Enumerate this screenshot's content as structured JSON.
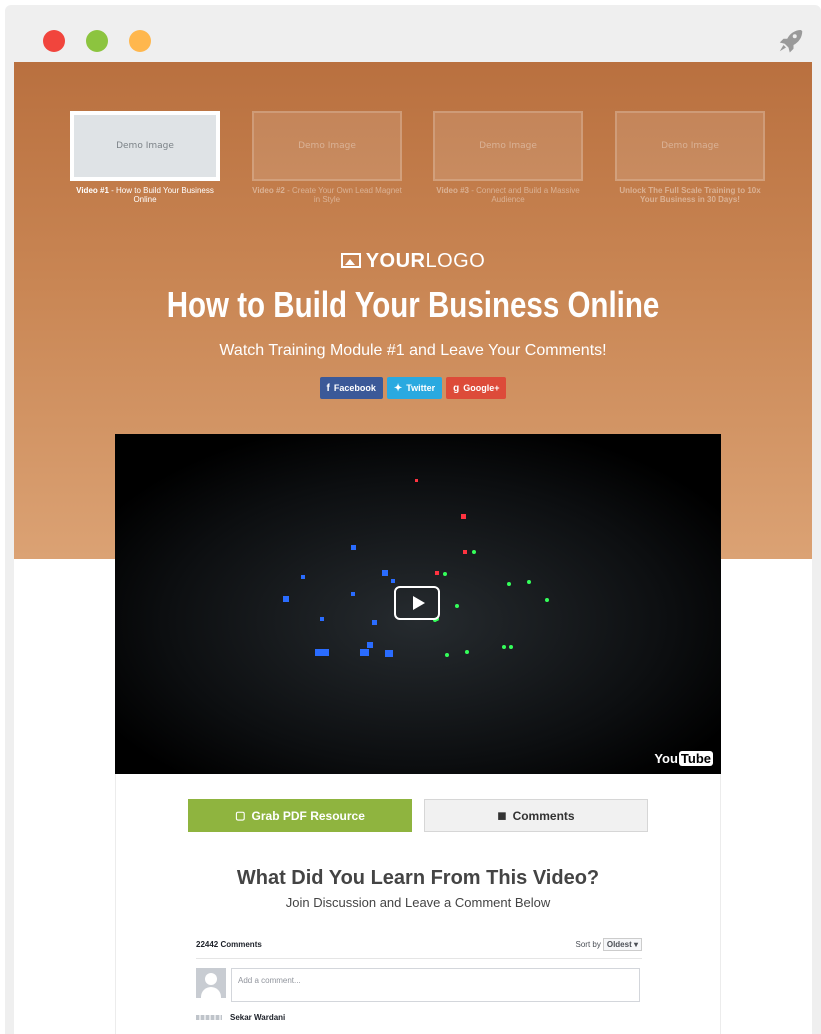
{
  "thumbnails": [
    {
      "image_text": "Demo Image",
      "number": "Video #1",
      "caption": " - How to Build Your Business Online"
    },
    {
      "image_text": "Demo Image",
      "number": "Video #2",
      "caption": " - Create Your Own Lead Magnet in Style"
    },
    {
      "image_text": "Demo Image",
      "number": "Video #3",
      "caption": " - Connect and Build a Massive Audience"
    },
    {
      "image_text": "Demo Image",
      "number": "",
      "caption": "Unlock The Full Scale Training to 10x Your Business in 30 Days!"
    }
  ],
  "logo": {
    "strong": "YOUR",
    "light": "LOGO"
  },
  "hero": {
    "title": "How to Build Your Business Online",
    "subtitle": "Watch Training Module #1 and Leave Your Comments!"
  },
  "share": {
    "facebook": "Facebook",
    "twitter": "Twitter",
    "google": "Google+"
  },
  "video": {
    "brand_you": "You",
    "brand_tube": "Tube"
  },
  "actions": {
    "pdf": "Grab PDF Resource",
    "comments": "Comments"
  },
  "discussion": {
    "title": "What Did You Learn From This Video?",
    "subtitle": "Join Discussion and Leave a Comment Below"
  },
  "comments": {
    "count": "22442 Comments",
    "sort_label": "Sort by",
    "sort_value": "Oldest",
    "placeholder": "Add a comment...",
    "first_author": "Sekar Wardani"
  },
  "colors": {
    "facebook": "#3b5998",
    "twitter": "#2aa9e0",
    "google": "#dd4b39",
    "pdf_button": "#8fb43f",
    "hero_top": "#b9703f"
  }
}
